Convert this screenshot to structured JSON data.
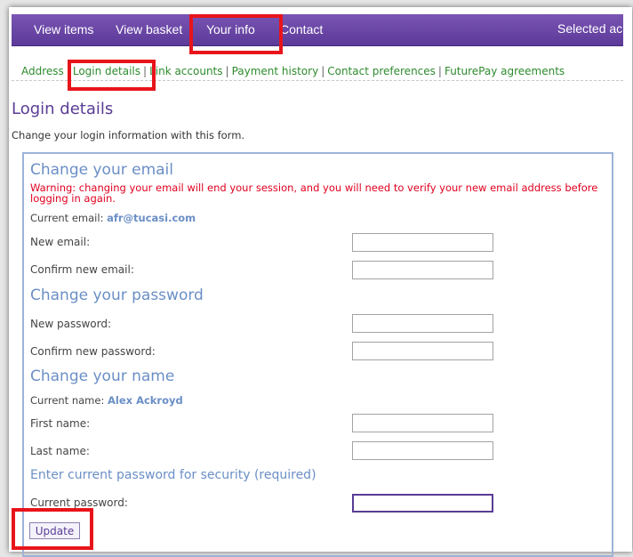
{
  "nav": {
    "items": [
      {
        "label": "View items"
      },
      {
        "label": "View basket"
      },
      {
        "label": "Your info"
      },
      {
        "label": "Contact"
      }
    ],
    "selected_text": "Selected ac"
  },
  "subnav": {
    "items": [
      {
        "label": "Address"
      },
      {
        "label": "Login details"
      },
      {
        "label": "Link accounts"
      },
      {
        "label": "Payment history"
      },
      {
        "label": "Contact preferences"
      },
      {
        "label": "FuturePay agreements"
      }
    ],
    "separator": "|"
  },
  "page": {
    "title": "Login details",
    "description": "Change your login information with this form."
  },
  "email_section": {
    "heading": "Change your email",
    "warning": "Warning: changing your email will end your session, and you will need to verify your new email address before logging in again.",
    "current_label": "Current email:",
    "current_value": "afr@tucasi.com",
    "new_label": "New email:",
    "new_value": "",
    "confirm_label": "Confirm new email:",
    "confirm_value": ""
  },
  "password_section": {
    "heading": "Change your password",
    "new_label": "New password:",
    "confirm_label": "Confirm new password:"
  },
  "name_section": {
    "heading": "Change your name",
    "current_label": "Current name:",
    "current_value": "Alex Ackroyd",
    "first_label": "First name:",
    "first_value": "",
    "last_label": "Last name:",
    "last_value": ""
  },
  "security_section": {
    "heading": "Enter current password for security (required)",
    "current_password_label": "Current password:"
  },
  "actions": {
    "update_label": "Update"
  },
  "colors": {
    "nav_purple": "#5c3a99",
    "link_green": "#2e8b2e",
    "heading_blue": "#6b8fc6",
    "warning_red": "#e0001f",
    "highlight_red": "#e8141b"
  }
}
